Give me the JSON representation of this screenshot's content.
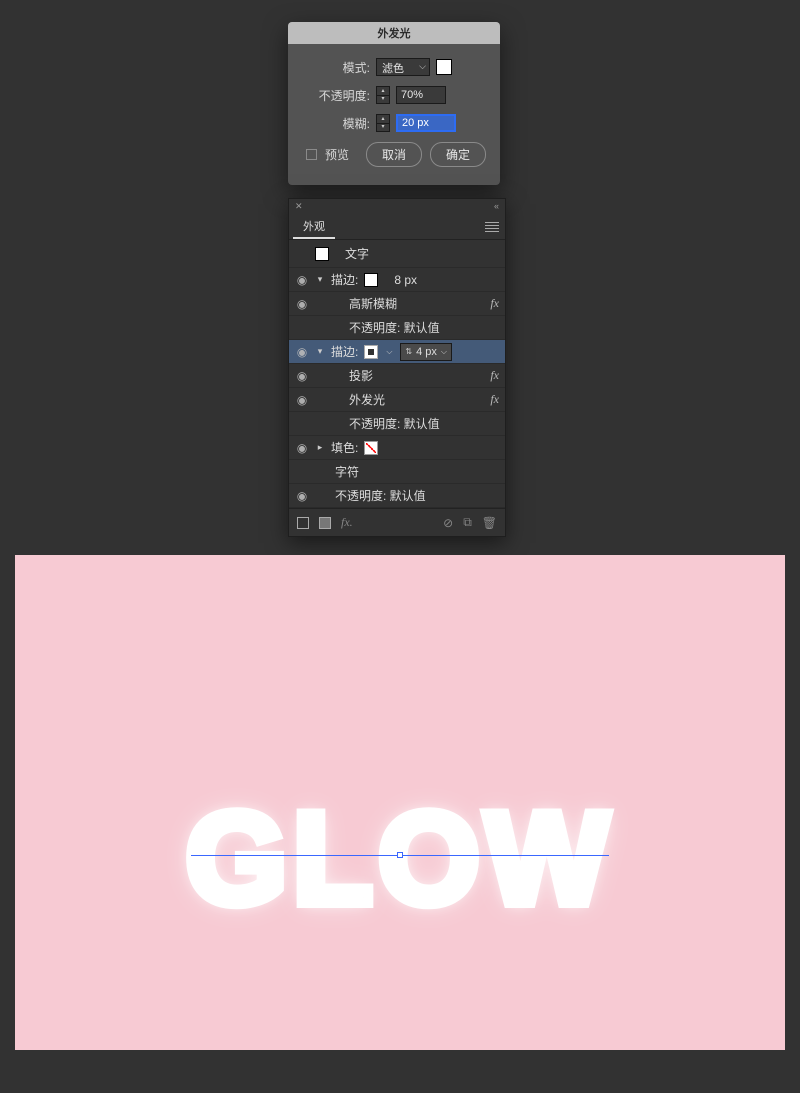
{
  "dialog": {
    "title": "外发光",
    "mode_label": "模式:",
    "mode_value": "滤色",
    "mode_swatch_color": "#ffffff",
    "opacity_label": "不透明度:",
    "opacity_value": "70%",
    "blur_label": "模糊:",
    "blur_value": "20 px",
    "preview_label": "预览",
    "cancel_label": "取消",
    "ok_label": "确定"
  },
  "appearance": {
    "tab_label": "外观",
    "type_row": {
      "label": "文字"
    },
    "rows": [
      {
        "kind": "stroke",
        "eye": true,
        "caret": "down",
        "label": "描边:",
        "swatch": "white",
        "value": "8 px",
        "selected": false
      },
      {
        "kind": "effect",
        "eye": true,
        "label": "高斯模糊",
        "fx": true,
        "indent": 2
      },
      {
        "kind": "opacity",
        "eye": false,
        "label": "不透明度: 默认值",
        "indent": 2
      },
      {
        "kind": "stroke",
        "eye": true,
        "caret": "down",
        "label": "描边:",
        "swatch": "outline",
        "value": "4 px",
        "value_dd": true,
        "selected": true
      },
      {
        "kind": "effect",
        "eye": true,
        "label": "投影",
        "fx": true,
        "indent": 2
      },
      {
        "kind": "effect",
        "eye": true,
        "label": "外发光",
        "fx": true,
        "indent": 2
      },
      {
        "kind": "opacity",
        "eye": false,
        "label": "不透明度: 默认值",
        "indent": 2
      },
      {
        "kind": "fill",
        "eye": true,
        "caret": "right",
        "label": "填色:",
        "swatch": "none",
        "indent": 1
      },
      {
        "kind": "char",
        "eye": false,
        "label": "字符",
        "indent": 1
      },
      {
        "kind": "opacity",
        "eye": true,
        "label": "不透明度: 默认值",
        "indent": 1
      }
    ]
  },
  "canvas": {
    "text": "GLOW",
    "bg": "#f7cad3"
  }
}
